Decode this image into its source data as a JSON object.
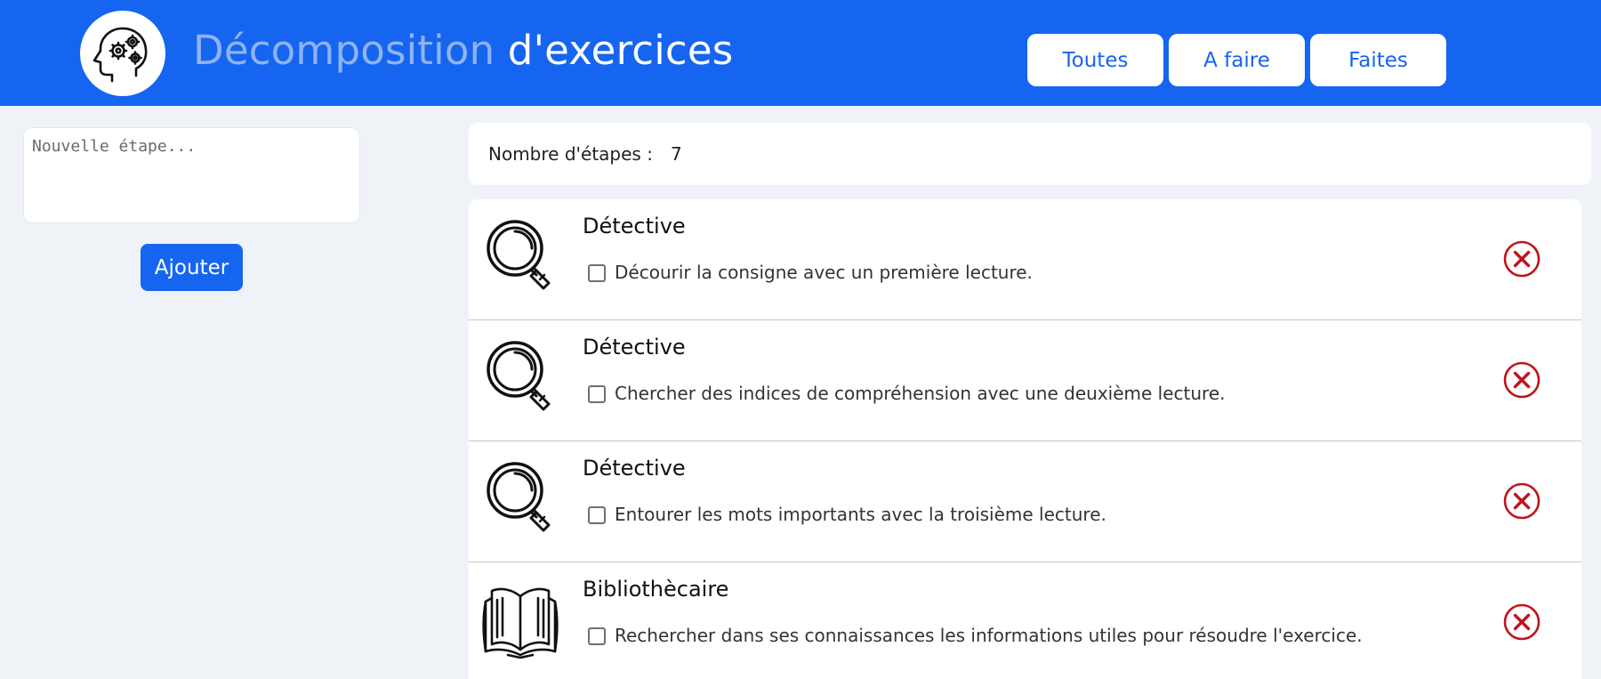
{
  "header": {
    "title_light": "Décomposition",
    "title_rest": " d'exercices",
    "logo_icon": "head-gears-icon",
    "filters": [
      {
        "label": "Toutes"
      },
      {
        "label": "A faire"
      },
      {
        "label": "Faites"
      }
    ]
  },
  "form": {
    "placeholder": "Nouvelle étape...",
    "value": "",
    "add_label": "Ajouter"
  },
  "summary": {
    "count_label": "Nombre d'étapes :",
    "count_value": "7"
  },
  "steps": [
    {
      "role": "Détective",
      "icon": "magnifier-icon",
      "text": "Décourir la consigne avec un première lecture.",
      "done": false
    },
    {
      "role": "Détective",
      "icon": "magnifier-icon",
      "text": "Chercher des indices de compréhension avec une deuxième lecture.",
      "done": false
    },
    {
      "role": "Détective",
      "icon": "magnifier-icon",
      "text": "Entourer les mots importants avec la troisième lecture.",
      "done": false
    },
    {
      "role": "Bibliothècaire",
      "icon": "open-book-icon",
      "text": "Rechercher dans ses connaissances les informations utiles pour résoudre l'exercice.",
      "done": false
    }
  ],
  "colors": {
    "brand": "#1565f0",
    "delete": "#c0141c",
    "background": "#eff3f8"
  }
}
